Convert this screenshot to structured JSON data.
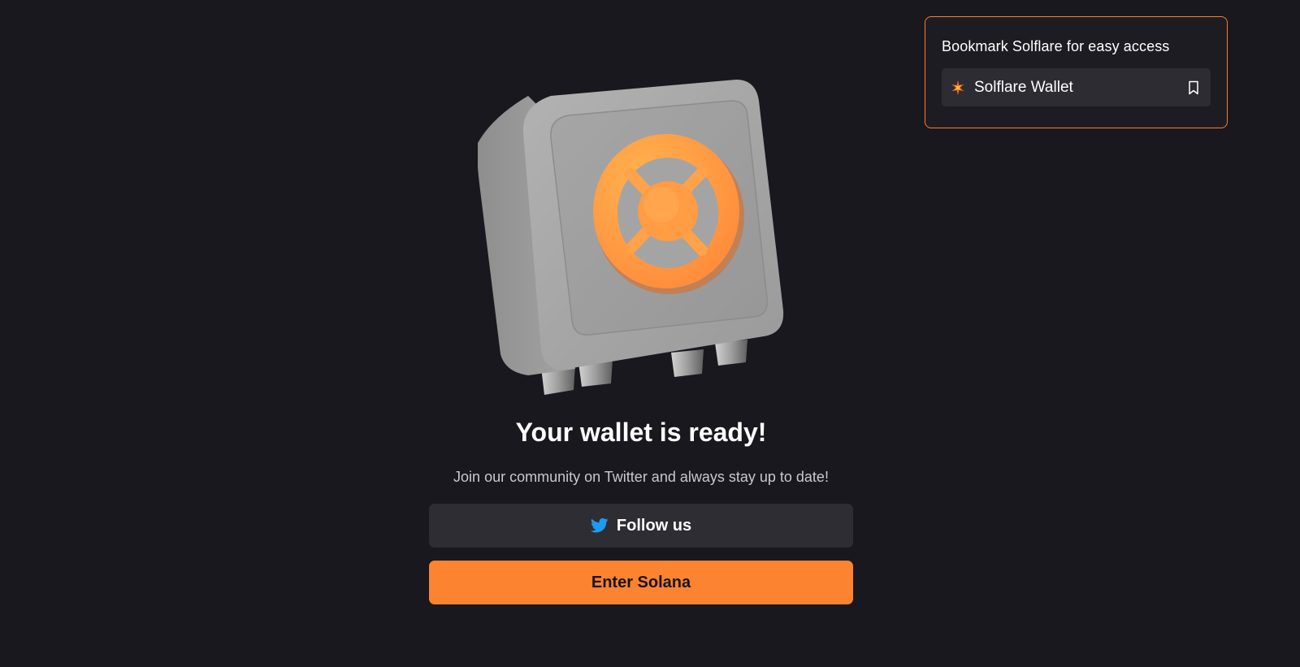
{
  "bookmark": {
    "title": "Bookmark Solflare for easy access",
    "item_label": "Solflare Wallet",
    "logo_icon": "solflare-logo-icon",
    "bookmark_icon": "bookmark-icon",
    "accent": "#fc7c2a"
  },
  "illustration": {
    "icon": "safe-vault-icon"
  },
  "main": {
    "heading": "Your wallet is ready!",
    "subtext": "Join our community on Twitter and always stay up to date!",
    "follow_label": "Follow us",
    "follow_icon": "twitter-icon",
    "enter_label": "Enter Solana"
  },
  "colors": {
    "background": "#19181f",
    "primary_button": "#fc832f",
    "secondary_button": "#2e2d34",
    "twitter_blue": "#1d9bf0"
  }
}
